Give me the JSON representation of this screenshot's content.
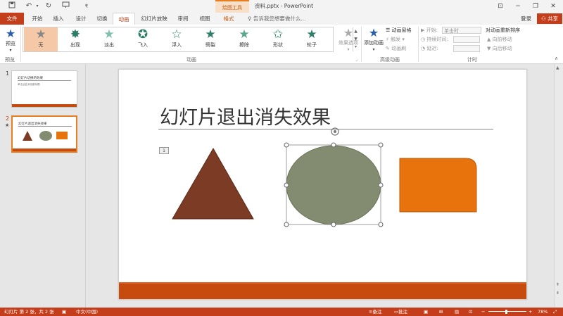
{
  "titlebar": {
    "doc_title": "资料.pptx - PowerPoint",
    "contextual_tools": "绘图工具",
    "qat": [
      "save",
      "undo",
      "redo",
      "present",
      "customize"
    ]
  },
  "tabs": {
    "file": "文件",
    "items": [
      "开始",
      "插入",
      "设计",
      "切换",
      "动画",
      "幻灯片放映",
      "审阅",
      "视图",
      "格式"
    ],
    "active": "动画",
    "tell_me": "告诉我您想要做什么...",
    "login": "登录",
    "share": "共享"
  },
  "ribbon": {
    "preview": {
      "label": "预览",
      "group": "预览"
    },
    "animation_group": "动画",
    "effects": [
      "无",
      "出现",
      "淡出",
      "飞入",
      "浮入",
      "劈裂",
      "擦除",
      "形状",
      "轮子"
    ],
    "effect_options": "效果选项",
    "add_animation": "添加动画",
    "advanced": {
      "pane": "动画窗格",
      "trigger": "触发",
      "painter": "动画刷",
      "group": "高级动画"
    },
    "timing": {
      "start_label": "开始:",
      "start_value": "单击时",
      "duration_label": "持续时间:",
      "delay_label": "延迟:",
      "reorder_title": "对动画重新排序",
      "move_earlier": "向前移动",
      "move_later": "向后移动",
      "group": "计时"
    }
  },
  "thumbnails": [
    {
      "number": "1",
      "title": "幻灯片切换的效果",
      "subtitle": "单击此处添加副标题"
    },
    {
      "number": "2",
      "title": "幻灯片退出消失效果",
      "starred": "★"
    }
  ],
  "slide": {
    "title": "幻灯片退出消失效果",
    "anim_tag": "1",
    "colors": {
      "triangle": "#7b3b24",
      "ellipse": "#838c71",
      "rect": "#e8730c",
      "bar": "#c74b0f"
    }
  },
  "statusbar": {
    "slide_info": "幻灯片 第 2 张，共 2 张",
    "language": "中文(中国)",
    "notes": "备注",
    "comments": "批注",
    "zoom": "78%"
  }
}
